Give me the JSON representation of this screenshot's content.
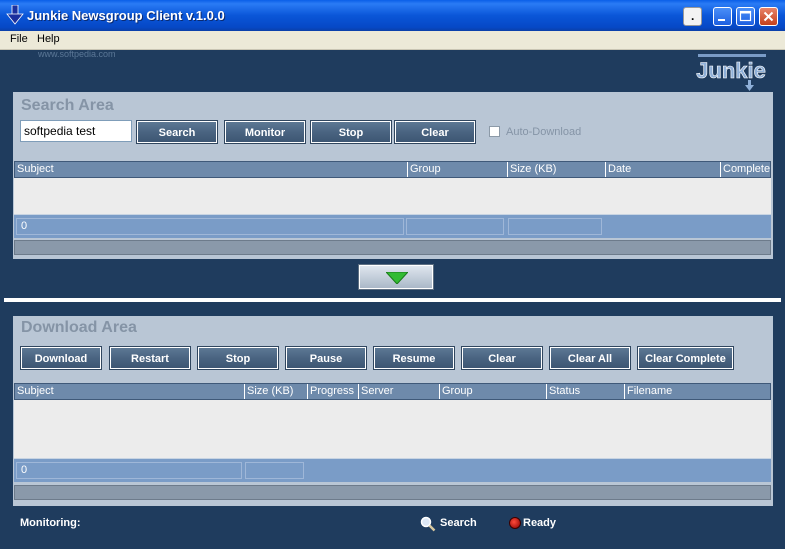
{
  "window": {
    "title": "Junkie Newsgroup Client v.1.0.0",
    "help_glyph": "."
  },
  "menu": [
    "File",
    "Help"
  ],
  "watermark": "www.softpedia.com",
  "logo_text": "Junkie",
  "search_area": {
    "title": "Search Area",
    "input_value": "softpedia test",
    "buttons": [
      "Search",
      "Monitor",
      "Stop",
      "Clear"
    ],
    "auto_download_label": "Auto-Download",
    "auto_download_checked": false,
    "columns": [
      "Subject",
      "Group",
      "Size (KB)",
      "Date",
      "Complete"
    ],
    "count": "0"
  },
  "download_area": {
    "title": "Download Area",
    "buttons": [
      "Download",
      "Restart",
      "Stop",
      "Pause",
      "Resume",
      "Clear",
      "Clear All",
      "Clear Complete"
    ],
    "columns": [
      "Subject",
      "Size (KB)",
      "Progress",
      "Server",
      "Group",
      "Status",
      "Filename"
    ],
    "count": "0"
  },
  "footer": {
    "monitoring_label": "Monitoring:",
    "search_status": "Search",
    "ready_status": "Ready"
  },
  "colors": {
    "background": "#1f3c5e",
    "panel": "#b9c6d5",
    "button": "#4a6481",
    "grid_header": "#6e8aab",
    "status_row": "#7a9cc7",
    "ready_indicator": "#c00000"
  }
}
